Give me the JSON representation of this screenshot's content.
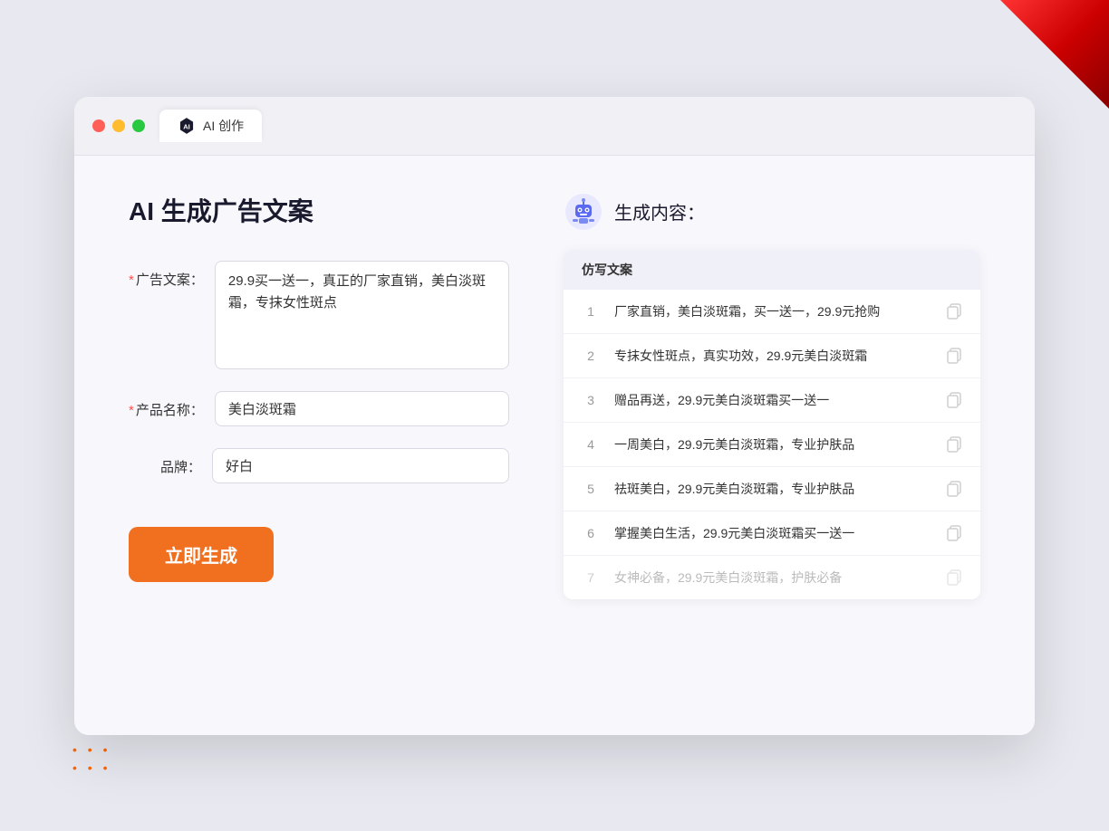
{
  "browser": {
    "tab_title": "AI 创作",
    "traffic_lights": [
      "red",
      "yellow",
      "green"
    ]
  },
  "left_panel": {
    "title": "AI 生成广告文案",
    "fields": [
      {
        "id": "ad_copy",
        "label": "广告文案：",
        "required": true,
        "type": "textarea",
        "value": "29.9买一送一，真正的厂家直销，美白淡斑霜，专抹女性斑点"
      },
      {
        "id": "product_name",
        "label": "产品名称：",
        "required": true,
        "type": "input",
        "value": "美白淡斑霜"
      },
      {
        "id": "brand",
        "label": "品牌：",
        "required": false,
        "type": "input",
        "value": "好白"
      }
    ],
    "generate_button": "立即生成"
  },
  "right_panel": {
    "title": "生成内容：",
    "column_header": "仿写文案",
    "results": [
      {
        "num": "1",
        "text": "厂家直销，美白淡斑霜，买一送一，29.9元抢购",
        "dimmed": false
      },
      {
        "num": "2",
        "text": "专抹女性斑点，真实功效，29.9元美白淡斑霜",
        "dimmed": false
      },
      {
        "num": "3",
        "text": "赠品再送，29.9元美白淡斑霜买一送一",
        "dimmed": false
      },
      {
        "num": "4",
        "text": "一周美白，29.9元美白淡斑霜，专业护肤品",
        "dimmed": false
      },
      {
        "num": "5",
        "text": "祛斑美白，29.9元美白淡斑霜，专业护肤品",
        "dimmed": false
      },
      {
        "num": "6",
        "text": "掌握美白生活，29.9元美白淡斑霜买一送一",
        "dimmed": false
      },
      {
        "num": "7",
        "text": "女神必备，29.9元美白淡斑霜，护肤必备",
        "dimmed": true
      }
    ]
  },
  "required_label": "*",
  "colors": {
    "accent": "#f07020",
    "primary": "#5b6af0",
    "text_dark": "#1a1a2e",
    "text_muted": "#999"
  }
}
